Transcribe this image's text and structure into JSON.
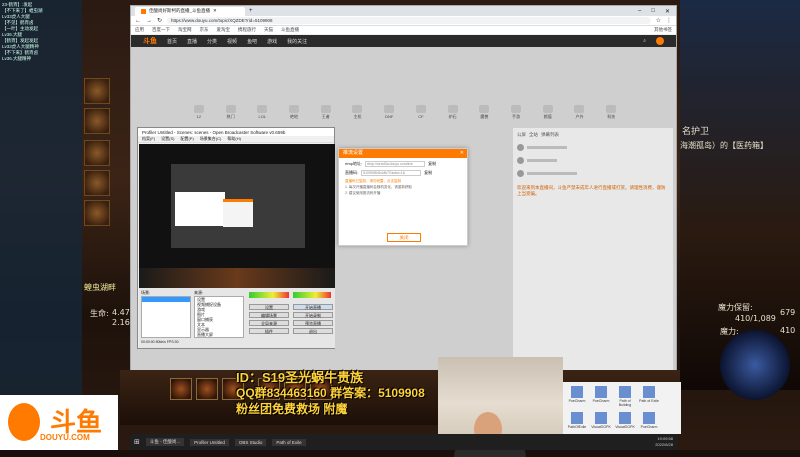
{
  "stream": {
    "id_line": "ID：S19圣光蜗牛贵族",
    "qq_line": "QQ群834463160 群答案：5109908",
    "fan_line": "粉丝团免费救场 附魔",
    "douyu_logo": "斗鱼",
    "douyu_sub": "DOUYU.COM"
  },
  "game": {
    "life_label": "生命:",
    "life_value_1": "4.47",
    "life_value_2": "2.16",
    "mana_label": "魔力:",
    "mana_value": "679",
    "mana_shield_label": "魔力保留:",
    "mana_shield_value": "410/1,089",
    "mana_label_2": "魔力:",
    "mana_value_2": "410",
    "side_text_1": "名护卫",
    "side_text_2": "海潮孤岛）的【医药箱】",
    "left_hint": "蝗虫湖畔"
  },
  "left_chat": {
    "lines": [
      "23-鹤宵】:发起",
      "【不下来了】蝗虫湖",
      "Lv33虎人大腿",
      "【不见】鹤宵卤",
      "【一叶】主动发起",
      "Lv36.大腿",
      "【鹤宵】发起发起",
      "Lv33虎人大腿精神",
      "【不下来】鹤宵卤",
      "Lv36.大腿精神"
    ]
  },
  "browser": {
    "tab_title": "佳酸尚好斯柯的直播_斗鱼直播",
    "url": "https://www.douyu.com/topic/XQZDE?rid=5109908",
    "bookmarks": [
      "应用",
      "百度一下",
      "淘宝网",
      "京东",
      "爱淘宝",
      "携程旅行",
      "天猫",
      "斗鱼直播",
      "其他书签"
    ],
    "nav": [
      "首页",
      "直播",
      "分类",
      "视频",
      "鱼吧",
      "游戏",
      "我的关注"
    ],
    "logo": "斗鱼",
    "categories": [
      "12",
      "热门",
      "LOL",
      "绝地",
      "王者",
      "主机",
      "DNF",
      "CF",
      "炉石",
      "魔兽",
      "手游",
      "颜值",
      "户外",
      "科技",
      "更多"
    ],
    "chat_rows": [
      "公屏",
      "全站",
      "弹幕列表"
    ],
    "chat_notice": "欢迎来到本直播间，斗鱼严禁未成年人进行直播或打赏。请理性消费，谨防上当受骗。"
  },
  "obs": {
    "title": "Profiler Untitled - Scenes: scenes - Open Broadcaster Software v0.659b",
    "menu": [
      "档案(F)",
      "设置(S)",
      "配置(P)",
      "场景集合(C)",
      "帮助(H)"
    ],
    "scenes_label": "场景:",
    "sources_label": "来源:",
    "sources": [
      "设置",
      "视频捕捉设备",
      "游戏",
      "图片",
      "窗口捕获",
      "文本",
      "显示器",
      "直播大屏"
    ],
    "buttons": [
      "设置",
      "开始直播",
      "编辑场景",
      "开始录制",
      "全局来源",
      "预览直播",
      "插件",
      "退出"
    ],
    "status": "00:00:00  50kb/s  FPS:30"
  },
  "dialog": {
    "title": "推流设置",
    "rtmp_label": "rtmp地址:",
    "rtmp_value": "rtmp://send3a.douyu.com/live",
    "key_label": "直播码:",
    "key_value": "5109908rSuMb7Gsdwi=1&",
    "copy_label": "复制",
    "note1": "直播码已复制，请勿泄露，点击复制",
    "note2": "1. 每次开播直播码会随机变化，请重新获取",
    "note3": "2. 建议使用推流码开播",
    "close_label": "关闭"
  },
  "taskbar": {
    "items": [
      "斗鱼 - 佳酸尚...",
      "Profiler Untitled",
      "OBS Studio",
      "Path of Exile"
    ],
    "time": "19:09:58",
    "date": "2022/6/28"
  },
  "dock": [
    "PoeCharm",
    "PoeCharm",
    "Path of Building",
    "Path of Exile",
    "PathOfExile",
    "VisualGGPK",
    "VisualGGPK",
    "PoeCharm"
  ]
}
